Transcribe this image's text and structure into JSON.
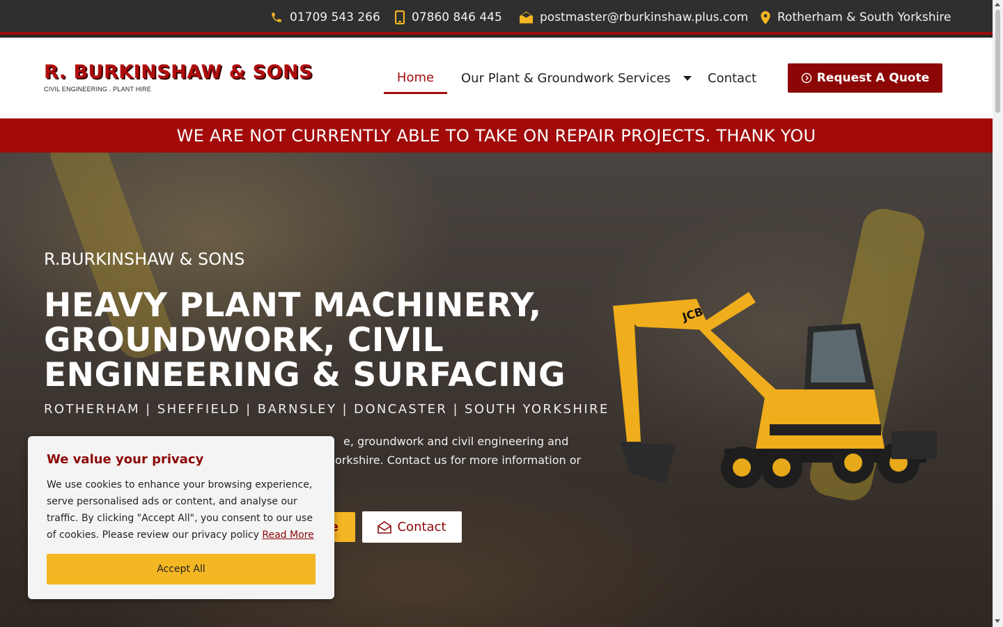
{
  "topbar": {
    "phone": "01709 543 266",
    "mobile": "07860 846 445",
    "email": "postmaster@rburkinshaw.plus.com",
    "location": "Rotherham & South Yorkshire",
    "icon_color": "#f4b623"
  },
  "header": {
    "logo_main": "R. BURKINSHAW & SONS",
    "logo_sub": "CIVIL ENGINEERING . PLANT HIRE",
    "nav": [
      {
        "label": "Home",
        "active": true
      },
      {
        "label": "Our Plant & Groundwork Services",
        "has_dropdown": true
      },
      {
        "label": "Contact"
      }
    ],
    "quote_button": "Request A Quote"
  },
  "banner": {
    "text": "WE ARE NOT CURRENTLY ABLE TO TAKE ON REPAIR PROJECTS. THANK YOU"
  },
  "hero": {
    "eyebrow": "R.BURKINSHAW & SONS",
    "title": "HEAVY PLANT MACHINERY, GROUNDWORK, CIVIL ENGINEERING & SURFACING",
    "locations": "ROTHERHAM | SHEFFIELD | BARNSLEY | DONCASTER | SOUTH YORKSHIRE",
    "body_visible_line1": "e, groundwork and civil engineering and",
    "body_visible_line2": "orkshire. Contact us for more information or",
    "quote_button_visible": "e",
    "contact_button": "Contact",
    "machine_brand": "JCB"
  },
  "cookie": {
    "title": "We value your privacy",
    "text": "We use cookies to enhance your browsing experience, serve personalised ads or content, and analyse our traffic. By clicking \"Accept All\", you consent to our use of cookies. Please review our privacy policy",
    "link": "Read More",
    "accept": "Accept All"
  },
  "colors": {
    "brand_red": "#a20a0a",
    "accent_yellow": "#f4b623",
    "topbar_bg": "#2f2f2f"
  }
}
